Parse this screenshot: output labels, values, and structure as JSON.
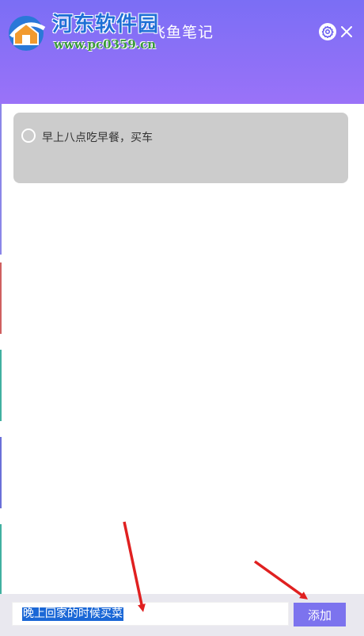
{
  "app": {
    "title": "飞鱼笔记"
  },
  "header": {
    "settings_icon": "gear-icon",
    "close_icon": "close-icon"
  },
  "watermark": {
    "name": "河东软件园",
    "url": "www.pc0359.cn"
  },
  "tasks": [
    {
      "text": "早上八点吃早餐，买车",
      "done": false
    }
  ],
  "input": {
    "value": "晚上回家的时候买菜",
    "selected": true
  },
  "add_button": {
    "label": "添加"
  },
  "colors": {
    "header_start": "#7b6ef5",
    "header_end": "#9a72f8",
    "card_bg": "#cccccc",
    "button_bg": "#7c73ee",
    "selection": "#1a67d6",
    "arrow": "#e02020"
  }
}
